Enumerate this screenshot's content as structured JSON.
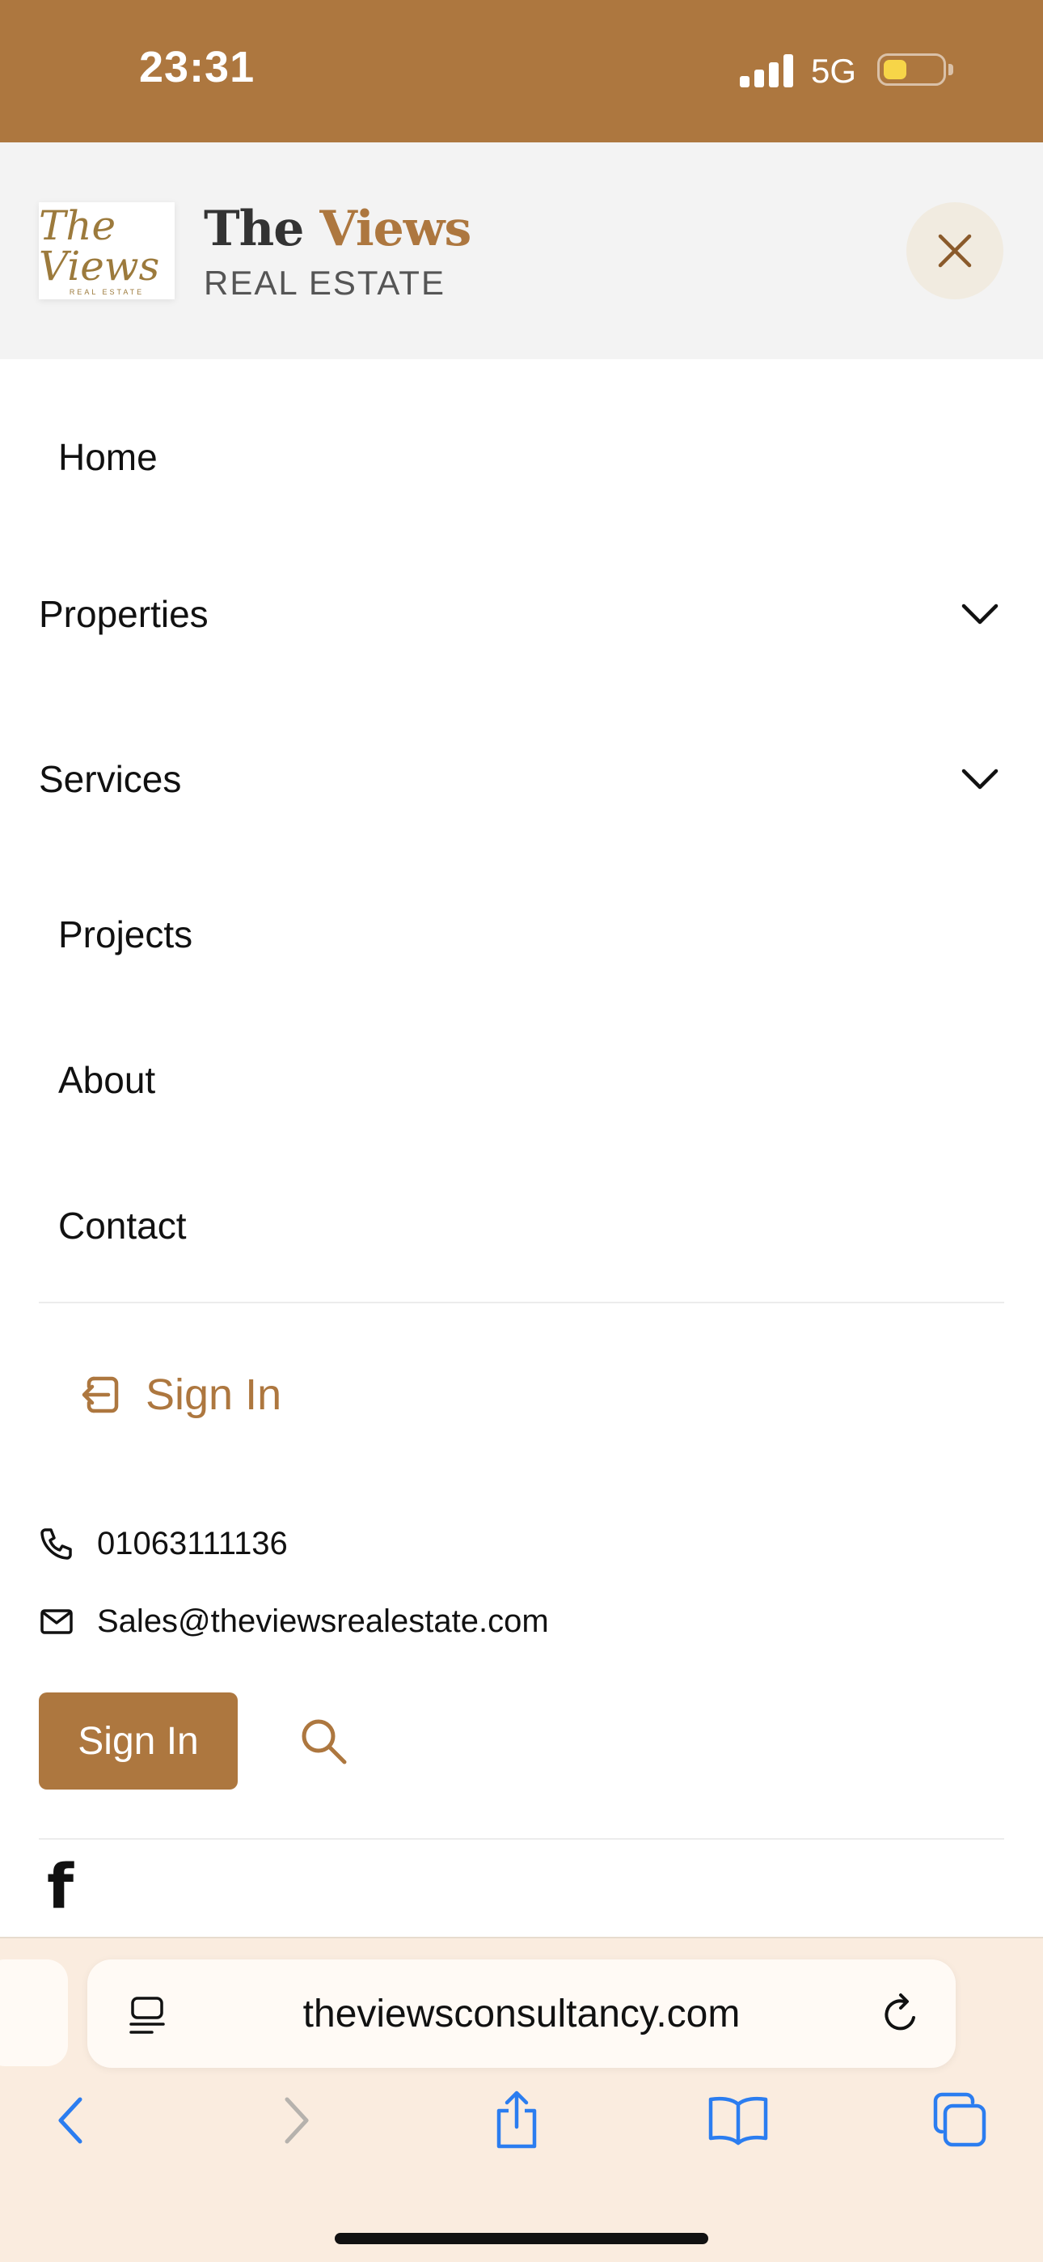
{
  "status_bar": {
    "time": "23:31",
    "network": "5G",
    "background": "#ad773f",
    "battery_color": "#f7d548"
  },
  "header": {
    "logo_script": "The Views",
    "logo_sub": "REAL ESTATE",
    "brand_primary": "The",
    "brand_accent": "Views",
    "brand_sub": "REAL ESTATE",
    "accent_color": "#ad773f",
    "close_icon": "close-icon"
  },
  "menu": {
    "items": [
      {
        "label": "Home",
        "has_submenu": false
      },
      {
        "label": "Properties",
        "has_submenu": true
      },
      {
        "label": "Services",
        "has_submenu": true
      },
      {
        "label": "Projects",
        "has_submenu": false
      },
      {
        "label": "About",
        "has_submenu": false
      },
      {
        "label": "Contact",
        "has_submenu": false
      }
    ]
  },
  "auth": {
    "signin_link": "Sign In",
    "signin_button": "Sign In"
  },
  "contact": {
    "phone": "01063111136",
    "email": "Sales@theviewsrealestate.com"
  },
  "social": {
    "facebook_icon": "facebook-icon"
  },
  "browser": {
    "url": "theviewsconsultancy.com",
    "tint": "#faecdf"
  }
}
